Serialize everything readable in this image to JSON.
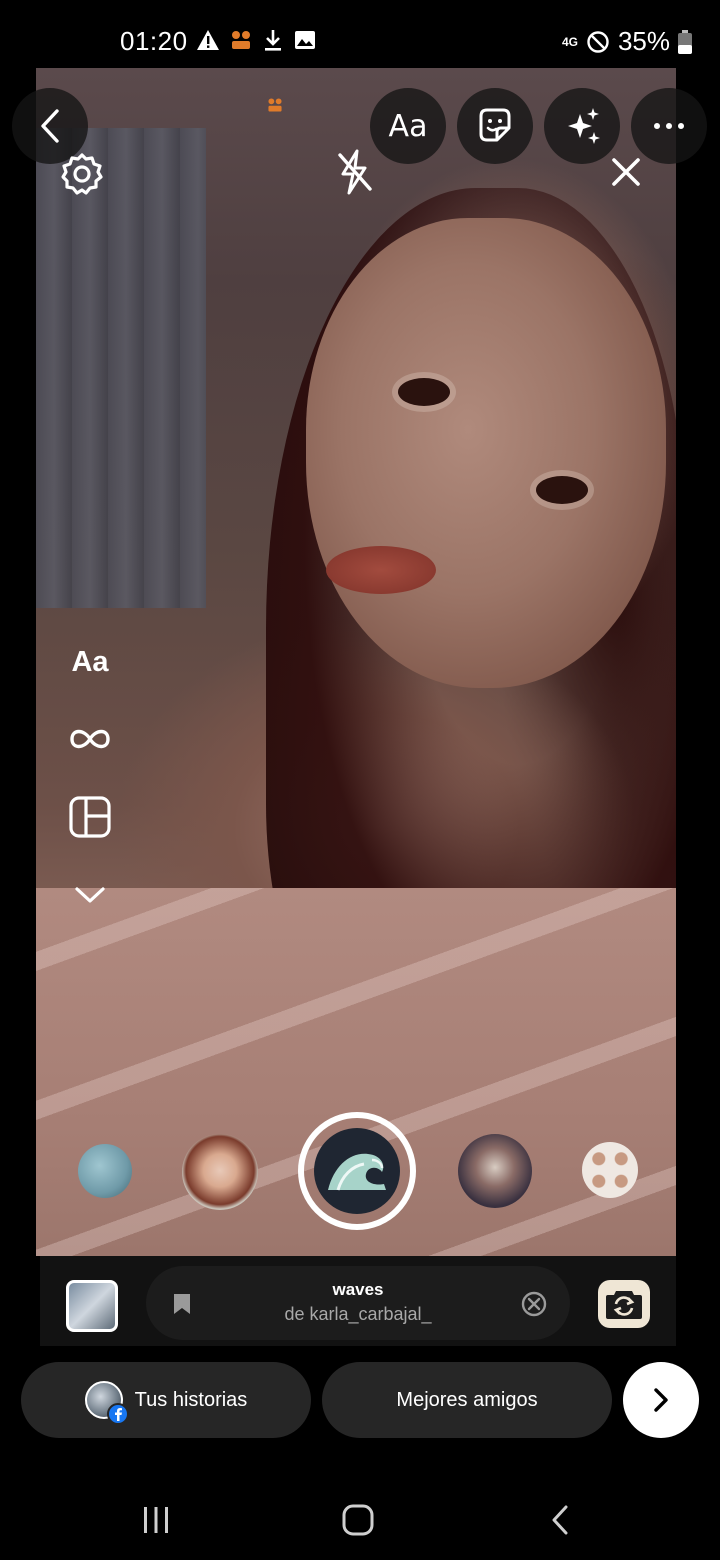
{
  "status_bar": {
    "time": "01:20",
    "network": "4G",
    "battery": "35%",
    "icons": [
      "warning-icon",
      "app-notification-icon",
      "download-icon",
      "image-icon",
      "do-not-disturb-icon",
      "battery-icon"
    ]
  },
  "camera": {
    "top_toolbar": [
      "back-icon",
      "text-tool",
      "sticker-icon",
      "effects-sparkle-icon",
      "more-icon"
    ],
    "text_tool_label": "Aa",
    "overlay_icons": [
      "settings-gear-icon",
      "flash-off-icon",
      "close-icon"
    ],
    "left_rail": {
      "create_label": "Aa",
      "items": [
        "create-text",
        "boomerang-icon",
        "layout-icon",
        "expand-chevron-icon"
      ]
    },
    "effects": [
      "effect-1",
      "effect-2",
      "effect-selected-waves",
      "effect-4",
      "effect-5"
    ]
  },
  "effect_info": {
    "name": "waves",
    "author": "de karla_carbajal_"
  },
  "share": {
    "your_story_label": "Tus historias",
    "close_friends_label": "Mejores amigos"
  },
  "colors": {
    "background": "#000000",
    "pill": "#262626",
    "effect_bar": "#121212",
    "facebook_badge": "#1877f2"
  }
}
